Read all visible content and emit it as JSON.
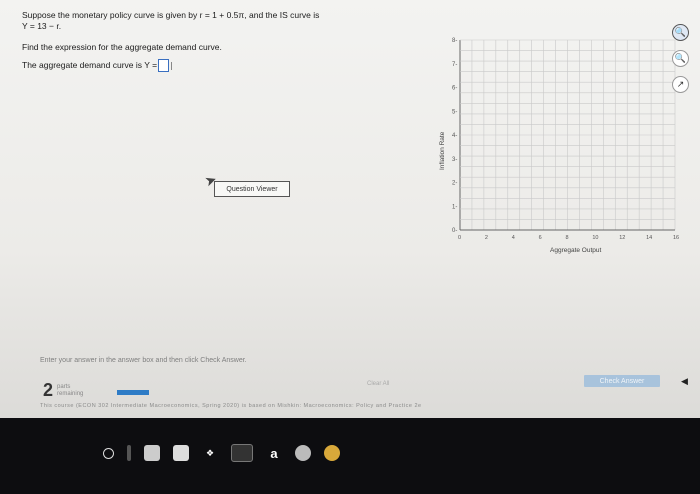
{
  "question": {
    "line1": "Suppose the monetary policy curve is given by r = 1 + 0.5π, and the IS curve is",
    "line2": "Y = 13 − r.",
    "prompt": "Find the expression for the aggregate demand curve.",
    "answer_prefix": "The aggregate demand curve is Y ="
  },
  "question_viewer": {
    "label": "Question Viewer"
  },
  "graph": {
    "ylabel": "Inflation Rate",
    "xlabel": "Aggregate Output",
    "yticks": [
      "0",
      "1",
      "2",
      "3",
      "4",
      "5",
      "6",
      "7",
      "8"
    ],
    "xticks": [
      "0",
      "2",
      "4",
      "6",
      "8",
      "10",
      "12",
      "14",
      "16"
    ]
  },
  "side_tools": [
    "zoom-in-icon",
    "zoom-out-icon",
    "popout-icon"
  ],
  "instruction": "Enter your answer in the answer box and then click Check Answer.",
  "parts": {
    "number": "2",
    "label1": "parts",
    "label2": "remaining",
    "progress": 0.5
  },
  "buttons": {
    "check_small": "Clear All",
    "check_answer": "Check Answer"
  },
  "footer": "This course (ECON 302 Intermediate Macroeconomics, Spring 2020) is based on Mishkin: Macroeconomics: Policy and Practice 2e",
  "taskbar": [
    "O",
    "",
    "",
    "",
    "",
    "",
    "a",
    "",
    ""
  ],
  "colors": {
    "accent": "#2e7cc6",
    "check_button": "#a8c3dc",
    "answer_border": "#3a6fc0"
  }
}
